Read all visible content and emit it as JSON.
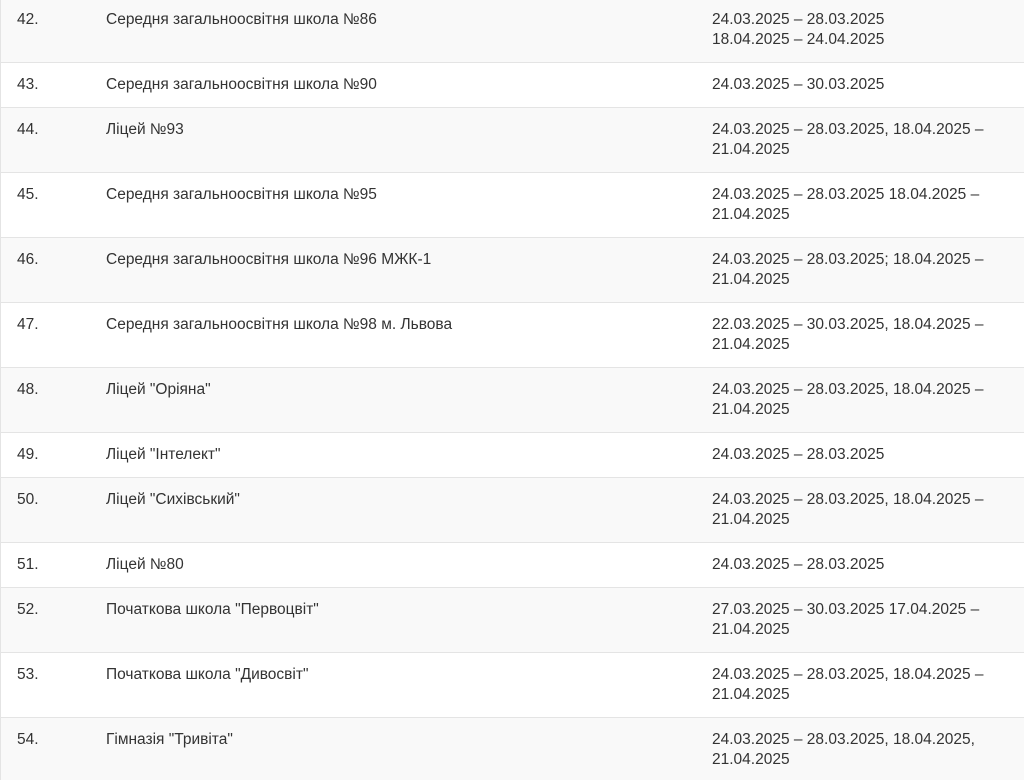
{
  "table": {
    "rows": [
      {
        "num": "42.",
        "name": "Середня загальноосвітня школа №86",
        "dates": [
          "24.03.2025 – 28.03.2025",
          "18.04.2025 – 24.04.2025"
        ]
      },
      {
        "num": "43.",
        "name": "Середня загальноосвітня школа №90",
        "dates": [
          "24.03.2025 – 30.03.2025"
        ]
      },
      {
        "num": "44.",
        "name": "Ліцей №93",
        "dates": [
          "24.03.2025 – 28.03.2025, 18.04.2025 –",
          "21.04.2025"
        ]
      },
      {
        "num": "45.",
        "name": "Середня загальноосвітня школа №95",
        "dates": [
          "24.03.2025 – 28.03.2025 18.04.2025 –",
          "21.04.2025"
        ]
      },
      {
        "num": "46.",
        "name": "Середня загальноосвітня школа №96 МЖК-1",
        "dates": [
          "24.03.2025 – 28.03.2025; 18.04.2025 –",
          "21.04.2025"
        ]
      },
      {
        "num": "47.",
        "name": "Середня загальноосвітня школа №98 м. Львова",
        "dates": [
          "22.03.2025 – 30.03.2025, 18.04.2025 –",
          "21.04.2025"
        ]
      },
      {
        "num": "48.",
        "name": "Ліцей \"Оріяна\"",
        "dates": [
          "24.03.2025 – 28.03.2025, 18.04.2025 –",
          "21.04.2025"
        ]
      },
      {
        "num": "49.",
        "name": "Ліцей \"Інтелект\"",
        "dates": [
          "24.03.2025 – 28.03.2025"
        ]
      },
      {
        "num": "50.",
        "name": "Ліцей \"Сихівський\"",
        "dates": [
          "24.03.2025 – 28.03.2025, 18.04.2025 –",
          "21.04.2025"
        ]
      },
      {
        "num": "51.",
        "name": "Ліцей №80",
        "dates": [
          "24.03.2025 – 28.03.2025"
        ]
      },
      {
        "num": "52.",
        "name": "Початкова школа \"Первоцвіт\"",
        "dates": [
          "27.03.2025 – 30.03.2025 17.04.2025 –",
          "21.04.2025"
        ]
      },
      {
        "num": "53.",
        "name": "Початкова школа \"Дивосвіт\"",
        "dates": [
          "24.03.2025 – 28.03.2025, 18.04.2025 –",
          "21.04.2025"
        ]
      },
      {
        "num": "54.",
        "name": "Гімназія \"Тривіта\"",
        "dates": [
          "24.03.2025 – 28.03.2025, 18.04.2025,",
          "21.04.2025"
        ]
      }
    ]
  }
}
